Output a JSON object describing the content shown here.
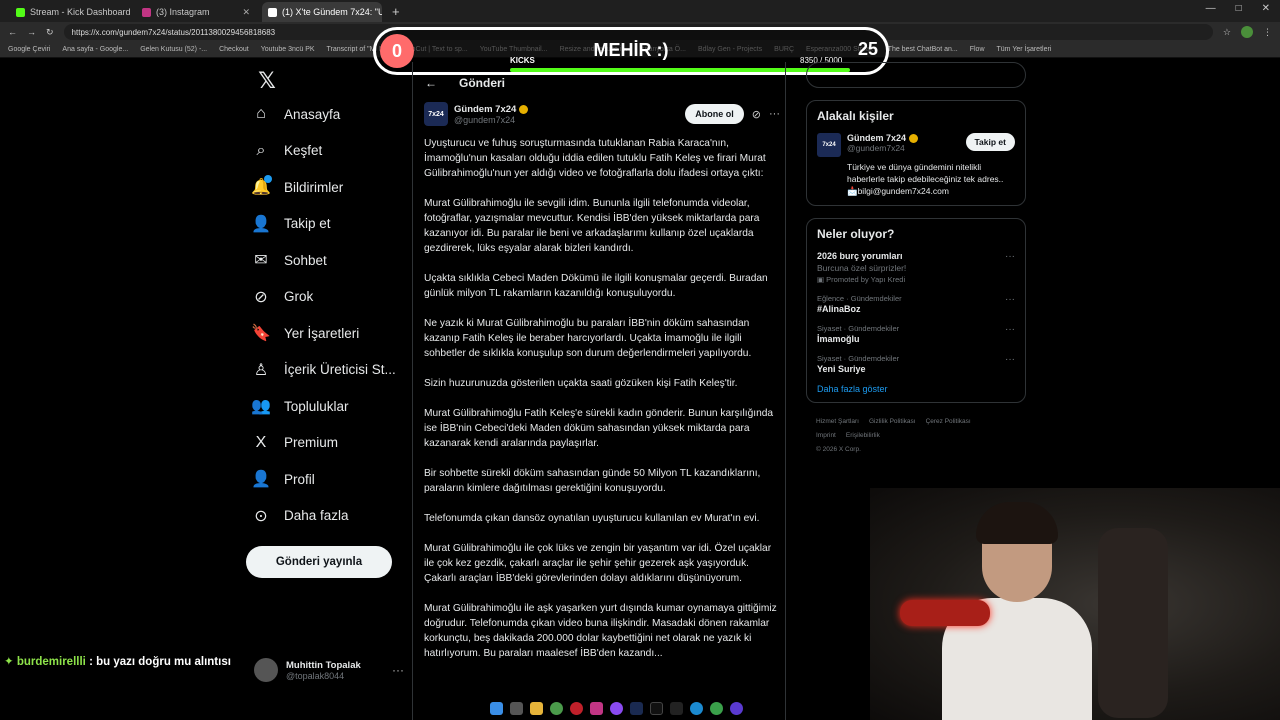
{
  "browser": {
    "tabs": [
      {
        "label": "Stream - Kick Dashboard",
        "active": false,
        "color": "#53fc18"
      },
      {
        "label": "(3) Instagram",
        "active": false,
        "color": "#c13584"
      },
      {
        "label": "(1) X'te Gündem 7x24: \"Uyuşt...",
        "active": true,
        "color": "#ffffff"
      }
    ],
    "url": "https://x.com/gundem7x24/status/2011380029456818683",
    "bookmarks": [
      "Google Çeviri",
      "Ana sayfa - Google...",
      "Gelen Kutusu (52) -...",
      "Checkout",
      "Youtube 3ncü PK",
      "Transcript of \"Mi M...",
      "CapCut | Text to sp...",
      "YouTube Thumbnail...",
      "Resize and reduce i...",
      "İspanyolca Ö...",
      "Bdlay Gen - Projects",
      "BURÇ",
      "Esperanza000 Strea...",
      "The best ChatBot an...",
      "Flow",
      "Tüm Yer İşaretleri"
    ]
  },
  "overlay": {
    "left_count": "0",
    "title": "MEHİR :)",
    "right_count": "25",
    "label": "KICKS",
    "progress_text": "8350  / 5000",
    "progress_fraction": 1.0,
    "accent": "#53fc18"
  },
  "sidebar": {
    "items": [
      {
        "label": "Anasayfa",
        "icon": "home-icon",
        "glyph": "⌂"
      },
      {
        "label": "Keşfet",
        "icon": "search-icon",
        "glyph": "⌕"
      },
      {
        "label": "Bildirimler",
        "icon": "bell-icon",
        "glyph": "🔔"
      },
      {
        "label": "Takip et",
        "icon": "add-user-icon",
        "glyph": "👤"
      },
      {
        "label": "Sohbet",
        "icon": "mail-icon",
        "glyph": "✉"
      },
      {
        "label": "Grok",
        "icon": "grok-icon",
        "glyph": "⊘"
      },
      {
        "label": "Yer İşaretleri",
        "icon": "bookmark-icon",
        "glyph": "🔖"
      },
      {
        "label": "İçerik Üreticisi St...",
        "icon": "creator-icon",
        "glyph": "♙"
      },
      {
        "label": "Topluluklar",
        "icon": "communities-icon",
        "glyph": "👥"
      },
      {
        "label": "Premium",
        "icon": "x-premium-icon",
        "glyph": "X"
      },
      {
        "label": "Profil",
        "icon": "profile-icon",
        "glyph": "👤"
      },
      {
        "label": "Daha fazla",
        "icon": "more-circle-icon",
        "glyph": "⊙"
      }
    ],
    "post_button": "Gönderi yayınla",
    "account": {
      "name": "Muhittin Topalak",
      "handle": "@topalak8044"
    }
  },
  "chat": {
    "user": "burdemirellli",
    "message": " : bu yazı doğru mu alıntısı"
  },
  "center": {
    "header_title": "Gönderi",
    "author": {
      "name": "Gündem 7x24",
      "handle": "@gundem7x24",
      "avatar_text": "7x24"
    },
    "follow_label": "Abone ol",
    "paragraphs": [
      "Uyuşturucu ve fuhuş soruşturmasında tutuklanan Rabia Karaca'nın, İmamoğlu'nun kasaları olduğu iddia edilen tutuklu Fatih Keleş ve firari Murat Gülibrahimoğlu'nun yer aldığı video ve fotoğraflarla dolu ifadesi ortaya çıktı:",
      "Murat Gülibrahimoğlu ile  sevgili idim. Bununla ilgili telefonumda videolar, fotoğraflar, yazışmalar mevcuttur.  Kendisi İBB'den yüksek miktarlarda para kazanıyor idi. Bu paralar ile beni ve arkadaşlarımı kullanıp özel uçaklarda gezdirerek, lüks eşyalar alarak bizleri kandırdı.",
      "Uçakta sıklıkla Cebeci Maden Dökümü ile ilgili konuşmalar geçerdi. Buradan günlük milyon TL rakamların kazanıldığı konuşuluyordu.",
      "Ne yazık ki Murat Gülibrahimoğlu bu paraları İBB'nin döküm sahasından kazanıp Fatih Keleş ile beraber harcıyorlardı. Uçakta İmamoğlu ile ilgili sohbetler de sıklıkla konuşulup son durum değerlendirmeleri yapılıyordu.",
      "Sizin huzurunuzda gösterilen uçakta saati gözüken kişi Fatih Keleş'tir.",
      "Murat Gülibrahimoğlu Fatih Keleş'e sürekli kadın gönderir. Bunun karşılığında ise İBB'nin Cebeci'deki Maden döküm sahasından yüksek miktarda para kazanarak kendi aralarında paylaşırlar.",
      "Bir sohbette sürekli döküm sahasından günde 50 Milyon TL kazandıklarını, paraların kimlere dağıtılması gerektiğini konuşuyordu.",
      "Telefonumda çıkan dansöz oynatılan uyuşturucu kullanılan ev Murat'ın evi.",
      "Murat Gülibrahimoğlu ile çok lüks ve zengin bir yaşantım var idi. Özel uçaklar ile çok kez gezdik, çakarlı araçlar ile şehir şehir gezerek aşk yaşıyorduk. Çakarlı araçları İBB'deki görevlerinden dolayı aldıklarını düşünüyorum.",
      "Murat Gülibrahimoğlu ile aşk yaşarken yurt dışında kumar oynamaya gittiğimiz doğrudur. Telefonumda çıkan video buna ilişkindir. Masadaki dönen rakamlar korkunçtu, beş dakikada 200.000 dolar kaybettiğini net olarak ne yazık ki hatırlıyorum. Bu paraları maalesef İBB'den kazandı..."
    ]
  },
  "right": {
    "related_title": "Alakalı kişiler",
    "person": {
      "name": "Gündem 7x24",
      "handle": "@gundem7x24",
      "follow": "Takip et",
      "bio": "Türkiye ve dünya gündemini nitelikli haberlerle takip edebileceğiniz tek adres.. 📩bilgi@gundem7x24.com",
      "avatar_text": "7x24"
    },
    "trends_title": "Neler oluyor?",
    "trends": [
      {
        "meta": "",
        "title": "2026 burç yorumları",
        "sub": "Burcuna özel sürprizler!",
        "promo": "Promoted by Yapı Kredi"
      },
      {
        "meta": "Eğlence · Gündemdekiler",
        "title": "#AlinaBoz",
        "sub": "",
        "promo": ""
      },
      {
        "meta": "Siyaset · Gündemdekiler",
        "title": "İmamoğlu",
        "sub": "",
        "promo": ""
      },
      {
        "meta": "Siyaset · Gündemdekiler",
        "title": "Yeni Suriye",
        "sub": "",
        "promo": ""
      }
    ],
    "show_more": "Daha fazla göster",
    "footer": [
      "Hizmet Şartları",
      "Gizlilik Politikası",
      "Çerez Politikası",
      "Imprint",
      "Erişilebilirlik",
      "© 2026 X Corp."
    ]
  }
}
